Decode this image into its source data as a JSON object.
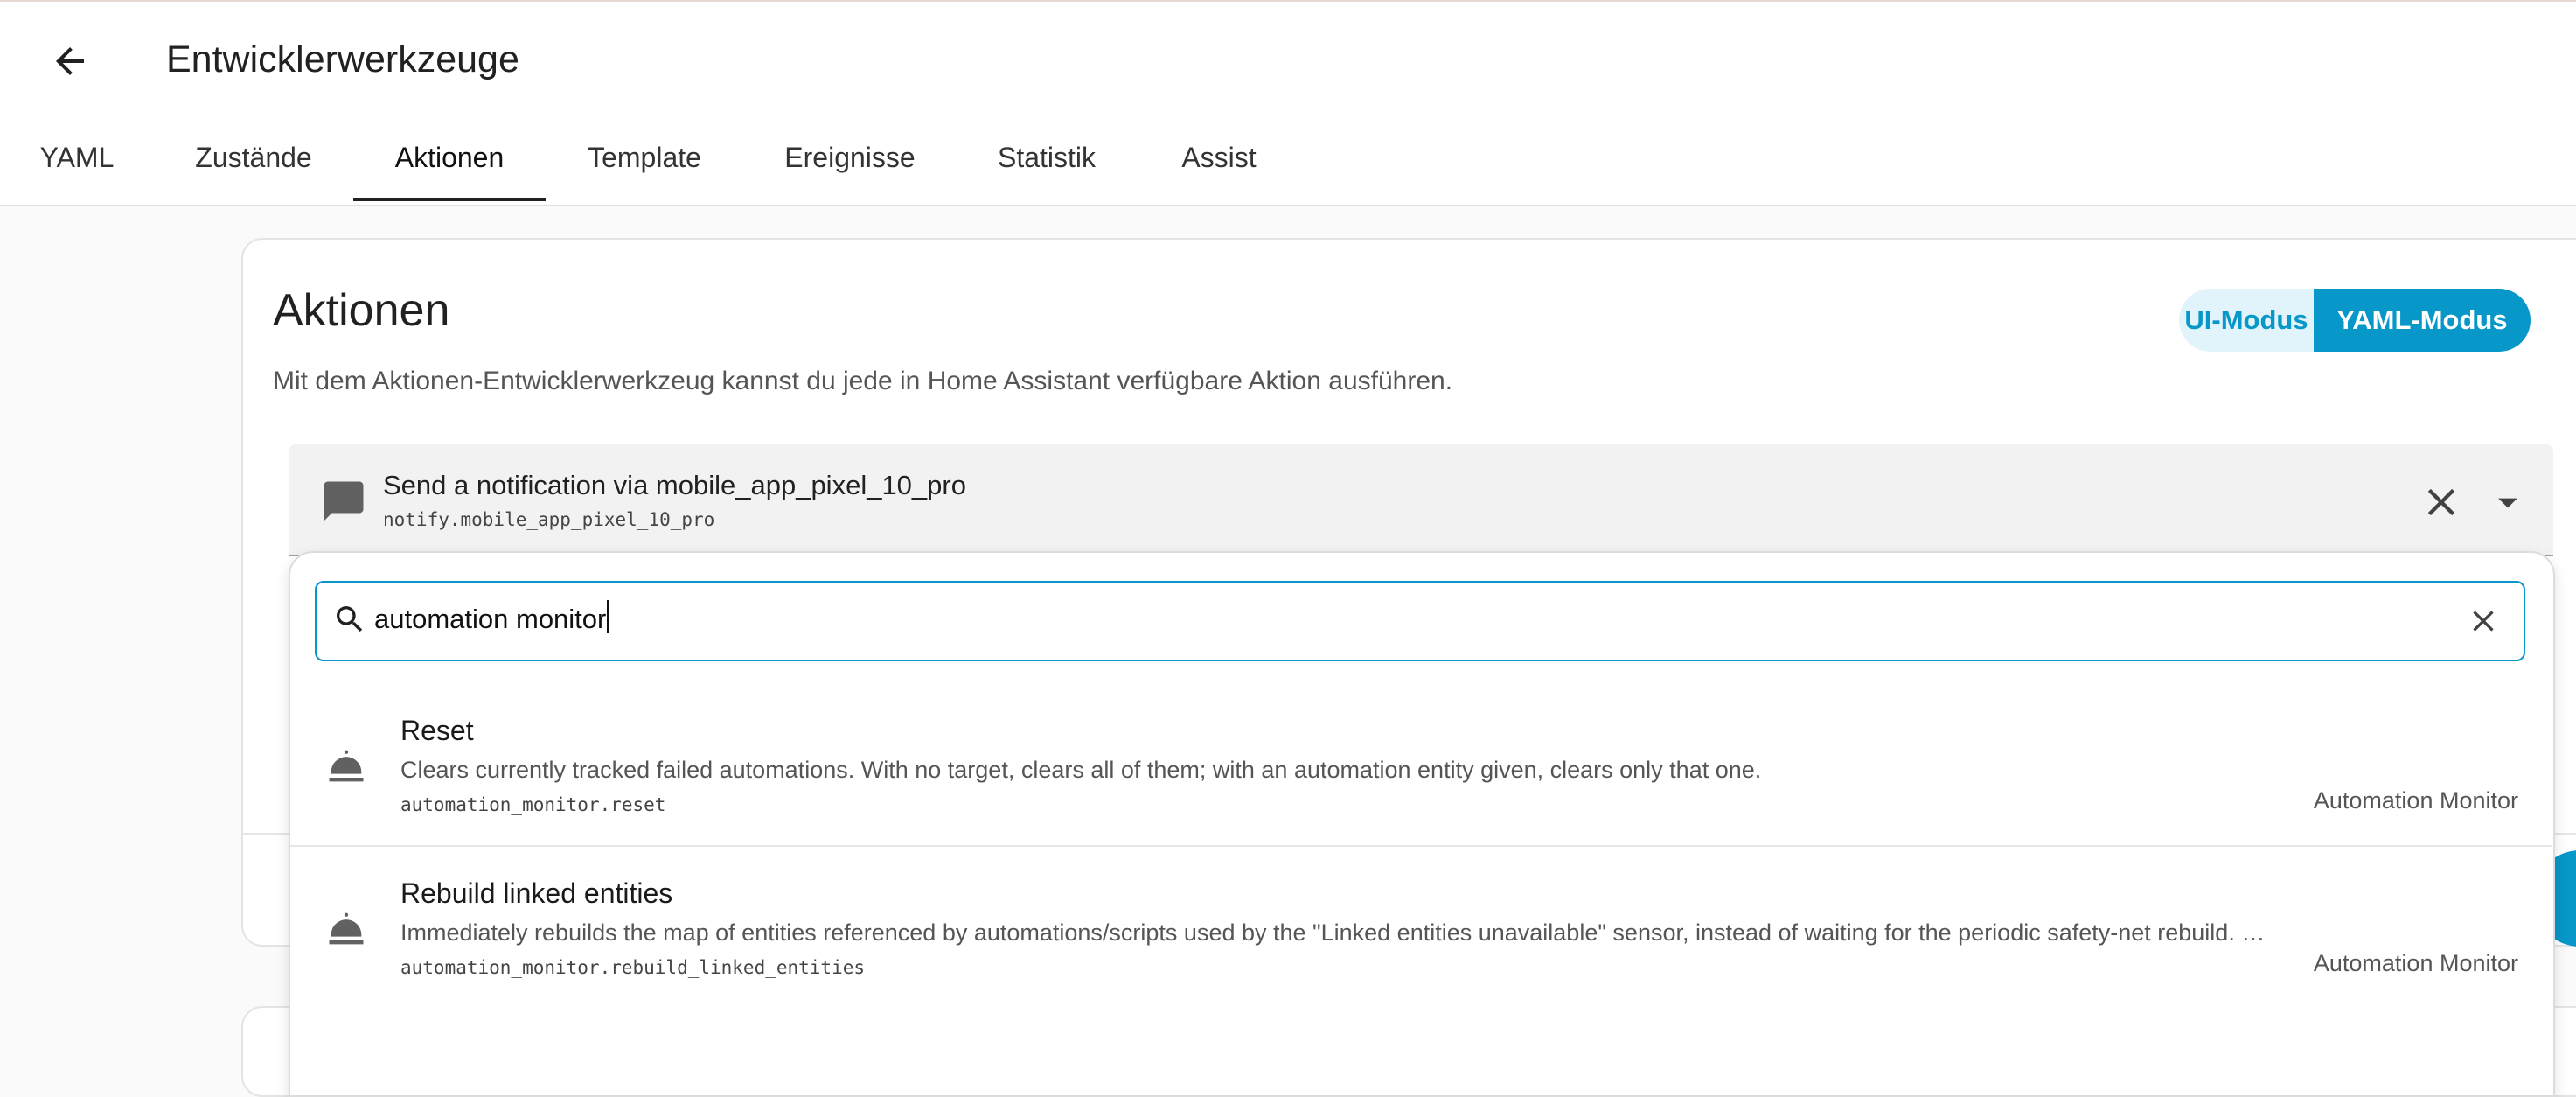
{
  "header": {
    "title": "Entwicklerwerkzeuge",
    "tabs": [
      {
        "label": "YAML"
      },
      {
        "label": "Zustände"
      },
      {
        "label": "Aktionen"
      },
      {
        "label": "Template"
      },
      {
        "label": "Ereignisse"
      },
      {
        "label": "Statistik"
      },
      {
        "label": "Assist"
      }
    ],
    "active_tab": "Aktionen"
  },
  "card": {
    "title": "Aktionen",
    "description": "Mit dem Aktionen-Entwicklerwerkzeug kannst du jede in Home Assistant verfügbare Aktion ausführen.",
    "mode_ui_label": "UI-Modus",
    "mode_yaml_label": "YAML-Modus",
    "active_mode": "YAML-Modus"
  },
  "action_select": {
    "name": "Send a notification via mobile_app_pixel_10_pro",
    "id": "notify.mobile_app_pixel_10_pro",
    "icon": "message-icon"
  },
  "search": {
    "value": "automation monitor"
  },
  "results": [
    {
      "title": "Reset",
      "description": "Clears currently tracked failed automations. With no target, clears all of them; with an automation entity given, clears only that one.",
      "id": "automation_monitor.reset",
      "integration": "Automation Monitor",
      "icon": "service-bell-icon"
    },
    {
      "title": "Rebuild linked entities",
      "description": "Immediately rebuilds the map of entities referenced by automations/scripts used by the \"Linked entities unavailable\" sensor, instead of waiting for the periodic safety-net rebuild. …",
      "id": "automation_monitor.rebuild_linked_entities",
      "integration": "Automation Monitor",
      "icon": "service-bell-icon"
    }
  ],
  "colors": {
    "accent": "#0797c8",
    "accent_light": "#e1f3fb",
    "field_bg": "#f2f2f2",
    "page_bg": "#fafafa"
  }
}
